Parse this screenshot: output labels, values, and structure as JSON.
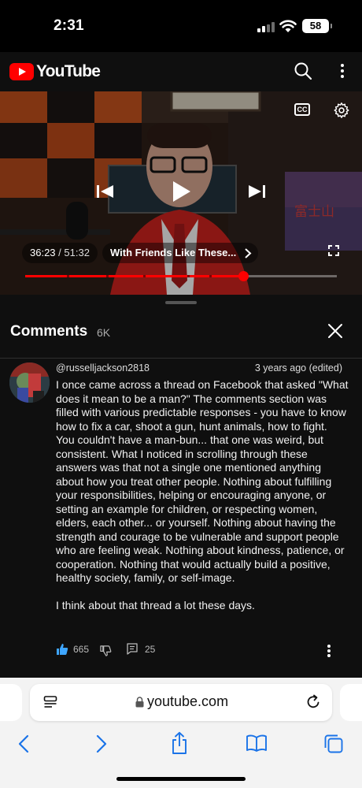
{
  "status_bar": {
    "time": "2:31",
    "battery": "58"
  },
  "header": {
    "logo_text": "YouTube",
    "icons": [
      "search-icon",
      "more-vert-icon"
    ]
  },
  "player": {
    "current_time": "36:23",
    "separator": "/",
    "duration": "51:32",
    "chapter_title": "With Friends Like These...",
    "cc_label": "CC",
    "progress_fraction": 0.7,
    "chapter_breaks": [
      0.135,
      0.26,
      0.38,
      0.52,
      0.59
    ],
    "sign_text": "富士山",
    "accent_color": "#ff0000"
  },
  "comments": {
    "title": "Comments",
    "count": "6K",
    "items": [
      {
        "author": "@russelljackson2818",
        "time": "3 years ago (edited)",
        "text": "I once came across a thread on Facebook that asked \"What does it mean to be a man?\" The comments section was filled with various predictable responses - you have to know how to fix a car, shoot a gun, hunt animals, how to fight. You couldn't have a man-bun... that one was weird, but consistent. What I noticed in scrolling through these answers was that not a single one mentioned anything about how you treat other people. Nothing about fulfilling your responsibilities, helping or encouraging anyone, or setting an example for children, or respecting women, elders, each other... or yourself. Nothing about having the strength and courage to be vulnerable and support people who are feeling weak. Nothing about kindness, patience, or cooperation. Nothing that would actually build a positive, healthy society, family, or self-image.\n\nI think about that thread a lot these days.",
        "likes": "665",
        "replies": "25"
      }
    ]
  },
  "browser": {
    "url": "youtube.com",
    "like_color": "#3ea6ff"
  }
}
